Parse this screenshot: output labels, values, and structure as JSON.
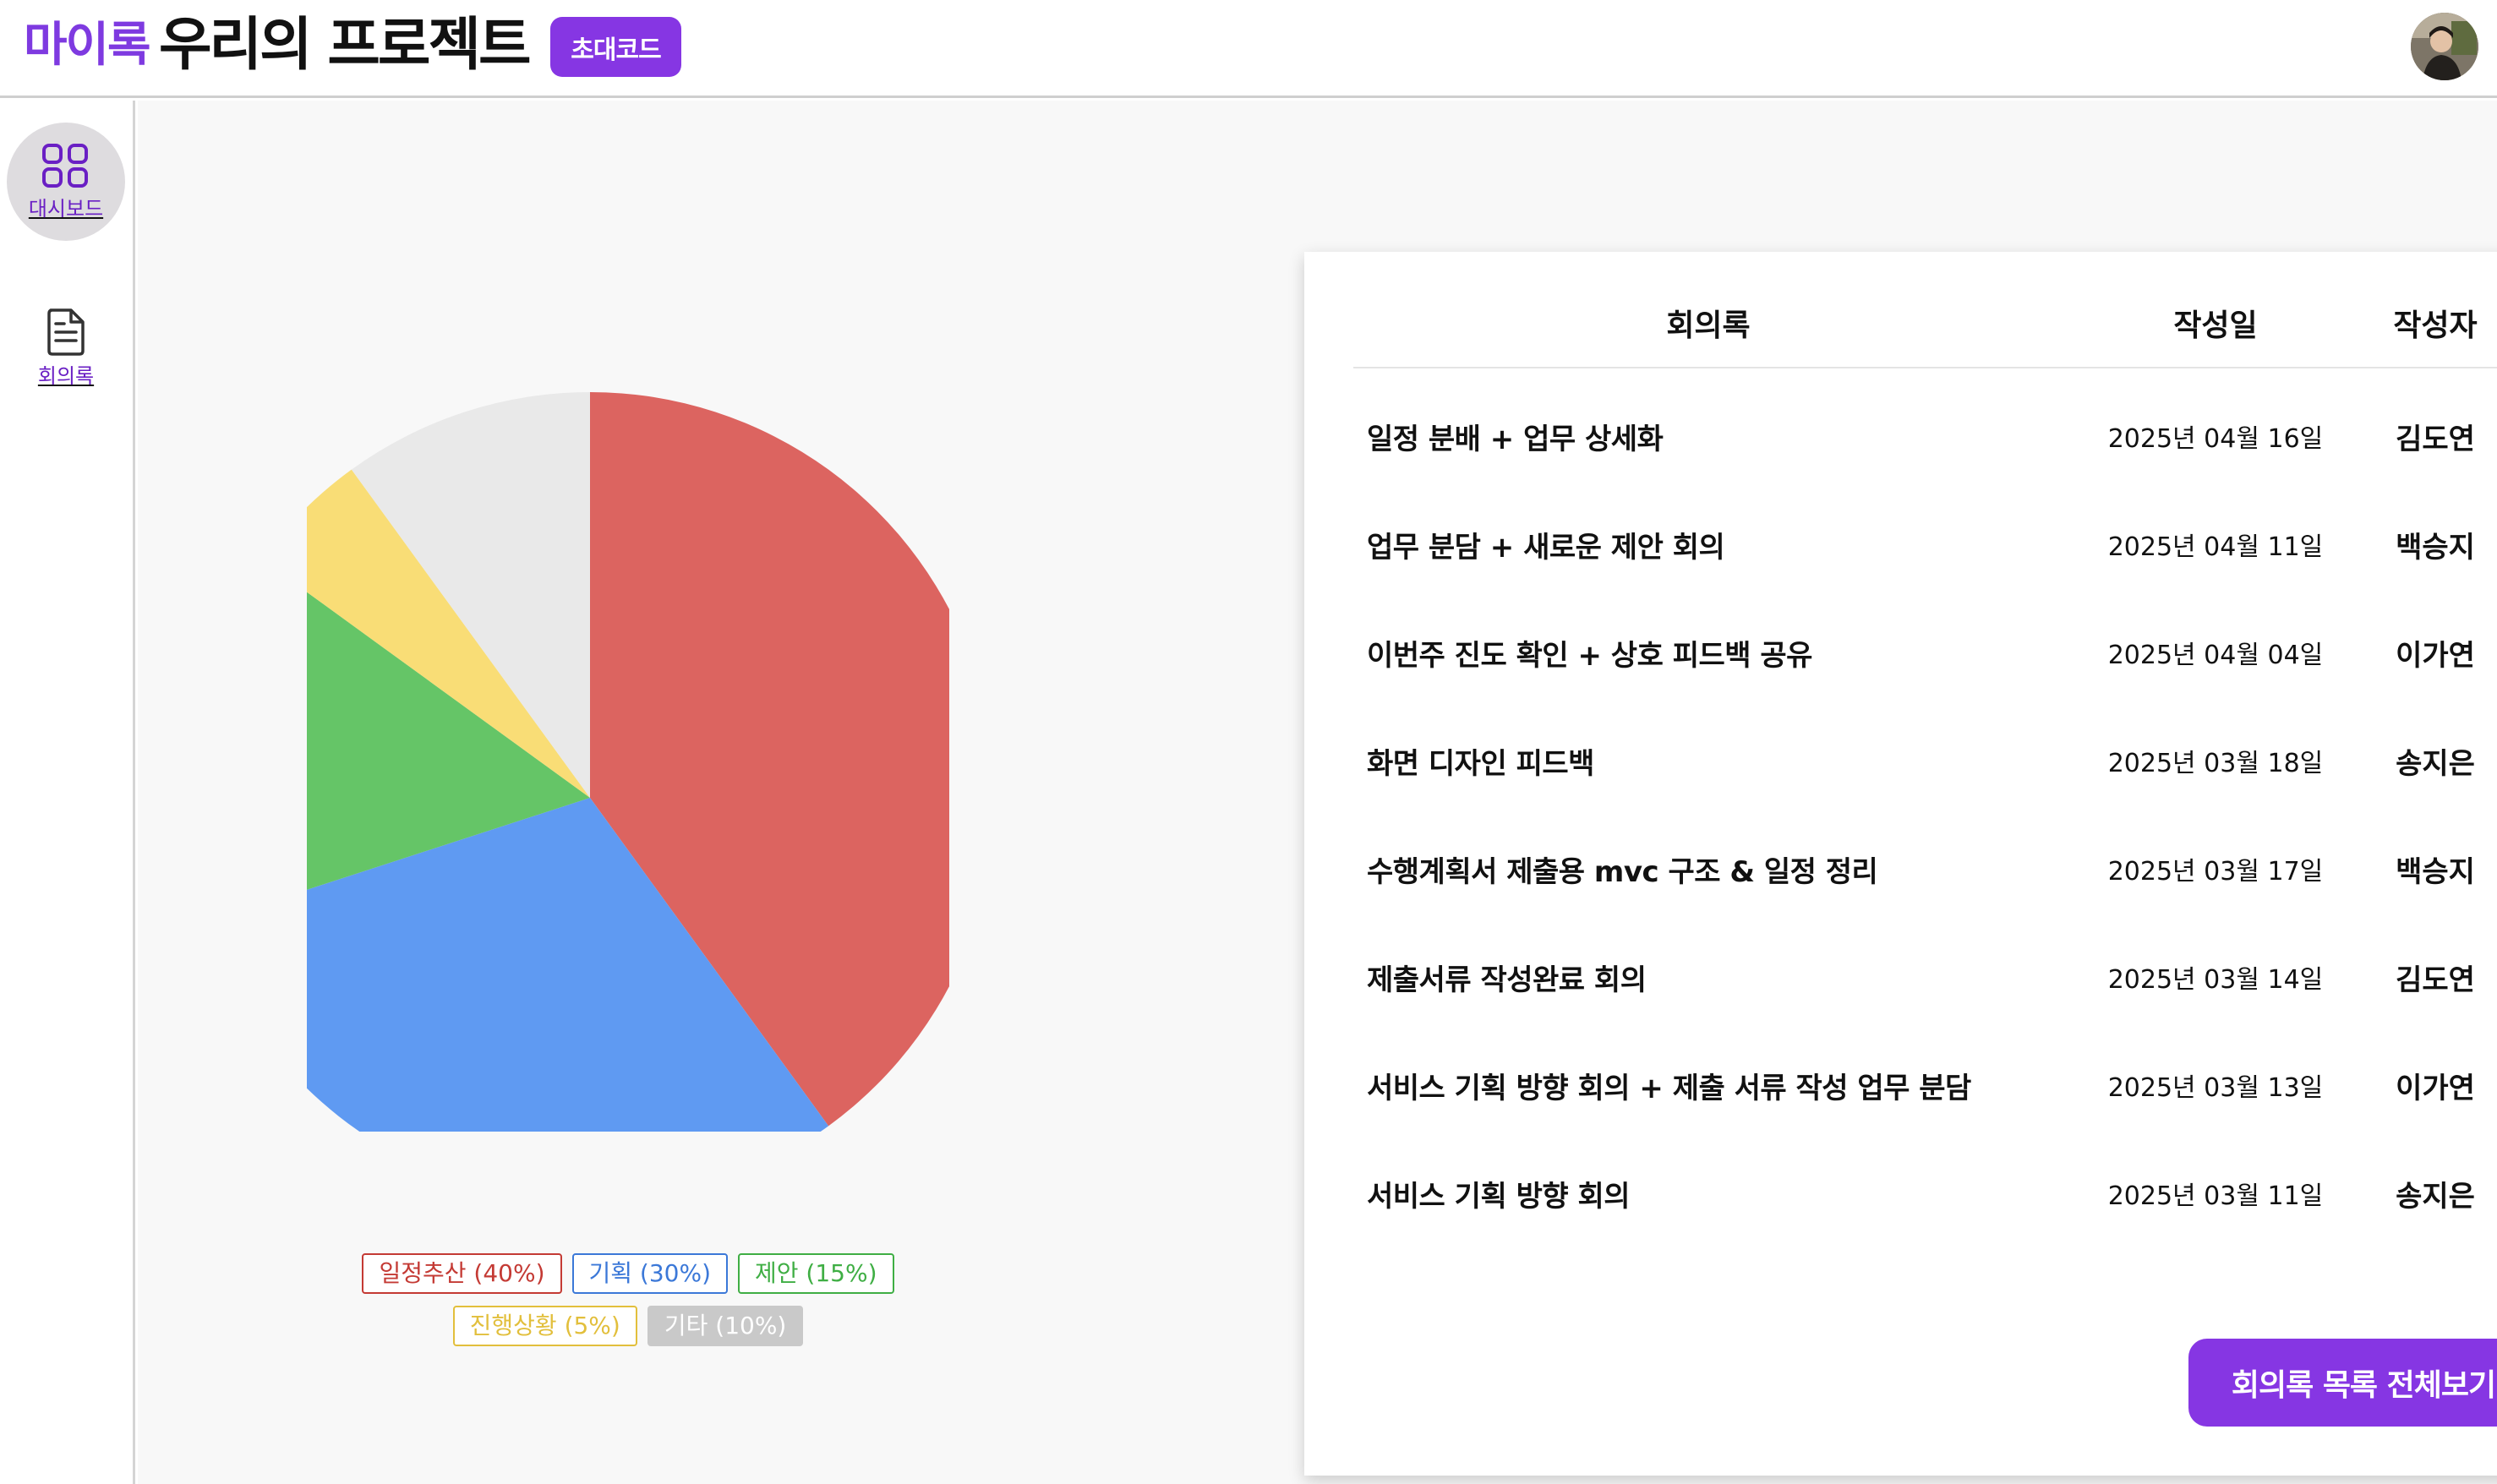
{
  "header": {
    "brand": "마이록",
    "project_title": "우리의 프로젝트",
    "invite_label": "초대코드",
    "colors": {
      "accent": "#8636e3",
      "brand": "#7e3ae0"
    }
  },
  "sidebar": {
    "items": [
      {
        "label": "대시보드",
        "icon": "grid-icon",
        "active": true
      },
      {
        "label": "회의록",
        "icon": "document-icon",
        "active": false
      }
    ]
  },
  "chart_data": {
    "type": "pie",
    "categories": [
      "일정추산",
      "기획",
      "제안",
      "진행상황",
      "기타"
    ],
    "values": [
      40,
      30,
      15,
      5,
      10
    ],
    "colors": [
      "#dc6460",
      "#5f9af2",
      "#65c567",
      "#f9dd76",
      "#e9e9e9"
    ],
    "legend_labels": [
      "일정추산 (40%)",
      "기획 (30%)",
      "제안 (15%)",
      "진행상황 (5%)",
      "기타 (10%)"
    ],
    "legend_colors": [
      "#c43a34",
      "#3b78d8",
      "#3fae44",
      "#e2bf3c",
      "#c9c9c9"
    ],
    "legend_placement": "bottom",
    "start_angle": "12 o'clock, clockwise"
  },
  "minutes": {
    "headers": {
      "title": "회의록",
      "date": "작성일",
      "author": "작성자"
    },
    "rows": [
      {
        "title": "일정 분배 + 업무 상세화",
        "date": "2025년 04월 16일",
        "author": "김도연"
      },
      {
        "title": "업무 분담 + 새로운 제안 회의",
        "date": "2025년 04월 11일",
        "author": "백승지"
      },
      {
        "title": "이번주 진도 확인 + 상호 피드백 공유",
        "date": "2025년 04월 04일",
        "author": "이가연"
      },
      {
        "title": "화면 디자인 피드백",
        "date": "2025년 03월 18일",
        "author": "송지은"
      },
      {
        "title": "수행계획서 제출용 mvc 구조 & 일정 정리",
        "date": "2025년 03월 17일",
        "author": "백승지"
      },
      {
        "title": "제출서류 작성완료 회의",
        "date": "2025년 03월 14일",
        "author": "김도연"
      },
      {
        "title": "서비스 기획 방향 회의 + 제출 서류 작성 업무 분담",
        "date": "2025년 03월 13일",
        "author": "이가연"
      },
      {
        "title": "서비스 기획 방향 회의",
        "date": "2025년 03월 11일",
        "author": "송지은"
      }
    ],
    "view_all_label": "회의록 목록 전체보기"
  }
}
